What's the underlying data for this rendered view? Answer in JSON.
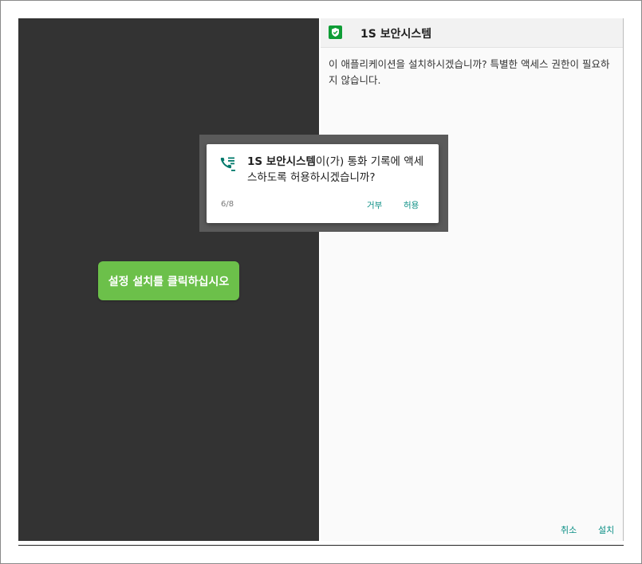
{
  "left_pane": {
    "cta_label": "설정 설치를 클릭하십시오",
    "cta_color": "#6cc04a",
    "background": "#333333"
  },
  "installer": {
    "app_name": "1S 보안시스템",
    "icon": "shield-check-icon",
    "message": "이 애플리케이션을 설치하시겠습니까? 특별한 액세스 권한이 필요하지 않습니다.",
    "cancel_label": "취소",
    "install_label": "설치",
    "accent_color": "#0b8f85"
  },
  "permission_dialog": {
    "icon": "phone-log-icon",
    "app_name": "1S 보안시스템",
    "request_text": "이(가) 통화 기록에 액세스하도록 허용하시겠습니까?",
    "counter": "6/8",
    "deny_label": "거부",
    "allow_label": "허용"
  }
}
